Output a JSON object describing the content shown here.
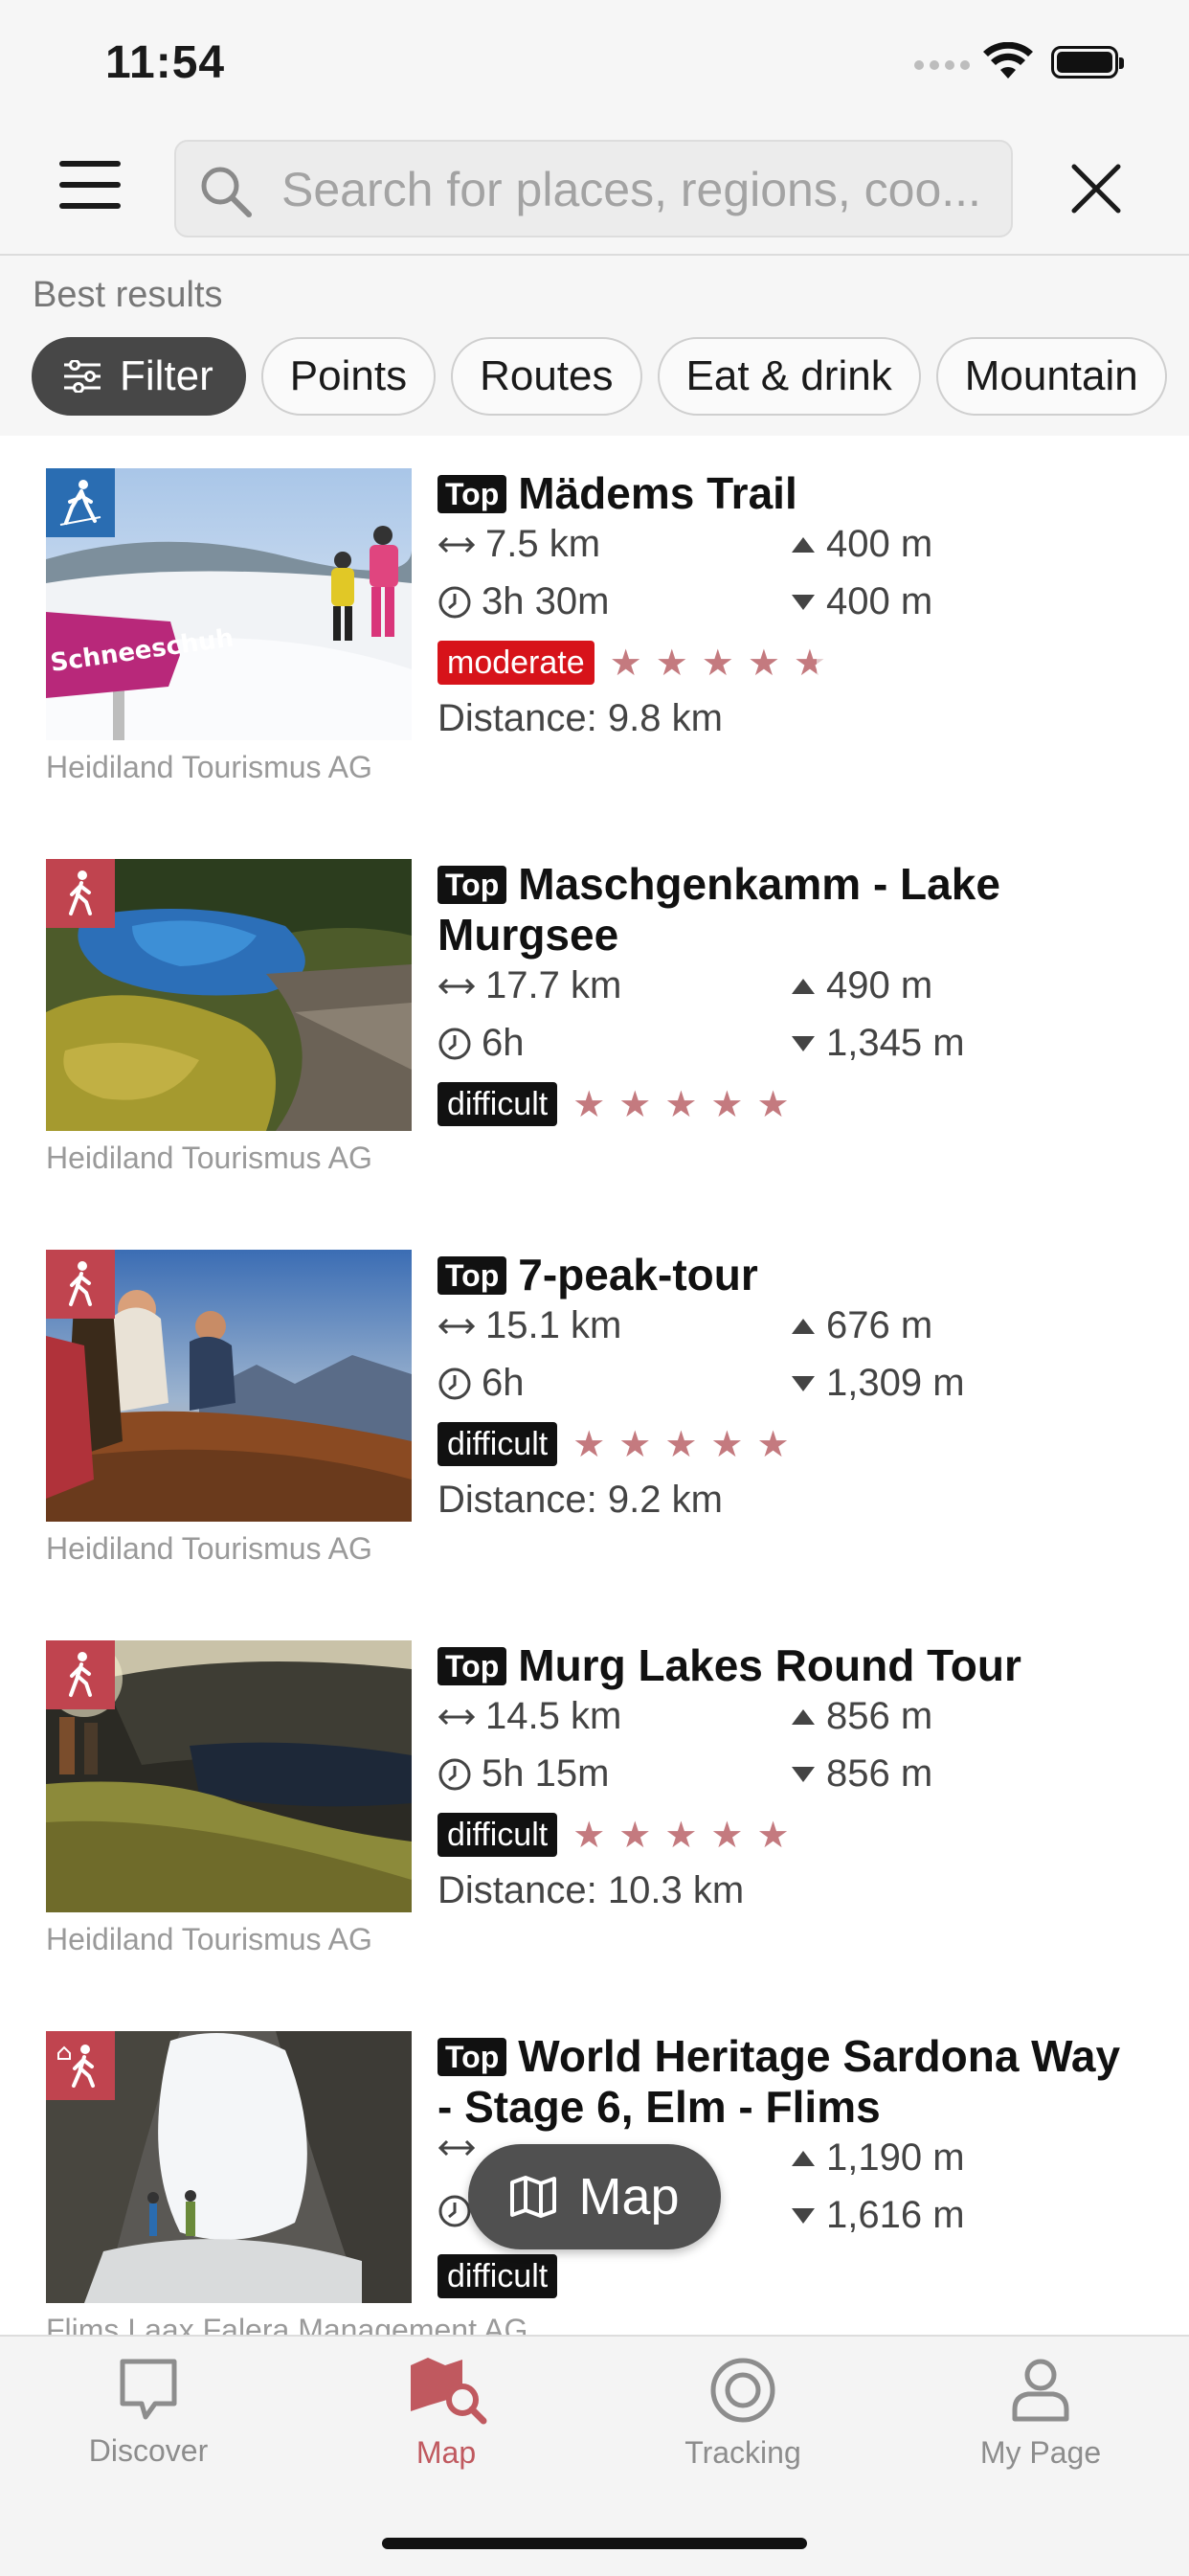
{
  "status_bar": {
    "time": "11:54"
  },
  "search": {
    "placeholder": "Search for places, regions, coo..."
  },
  "section": {
    "label": "Best results"
  },
  "chips": [
    "Filter",
    "Points",
    "Routes",
    "Eat & drink",
    "Mountain"
  ],
  "top_label": "Top",
  "results": [
    {
      "title": "Mädems Trail",
      "length": "7.5 km",
      "duration": "3h 30m",
      "ascent": "400 m",
      "descent": "400 m",
      "difficulty": "moderate",
      "rating_stars": 4.5,
      "distance": "Distance: 9.8 km",
      "credit": "Heidiland Tourismus AG",
      "activity_icon": "snowshoe-icon",
      "badge_color": "#2a6db2"
    },
    {
      "title": "Maschgenkamm - Lake Murgsee",
      "length": "17.7 km",
      "duration": "6h",
      "ascent": "490 m",
      "descent": "1,345 m",
      "difficulty": "difficult",
      "rating_stars": 5,
      "distance": "",
      "credit": "Heidiland Tourismus AG",
      "activity_icon": "hiking-icon",
      "badge_color": "#c0444f"
    },
    {
      "title": "7-peak-tour",
      "length": "15.1 km",
      "duration": "6h",
      "ascent": "676 m",
      "descent": "1,309 m",
      "difficulty": "difficult",
      "rating_stars": 5,
      "distance": "Distance: 9.2 km",
      "credit": "Heidiland Tourismus AG",
      "activity_icon": "hiking-icon",
      "badge_color": "#c0444f"
    },
    {
      "title": "Murg Lakes Round Tour",
      "length": "14.5 km",
      "duration": "5h 15m",
      "ascent": "856 m",
      "descent": "856 m",
      "difficulty": "difficult",
      "rating_stars": 5,
      "distance": "Distance: 10.3 km",
      "credit": "Heidiland Tourismus AG",
      "activity_icon": "hiking-icon",
      "badge_color": "#c0444f"
    },
    {
      "title": "World Heritage Sardona Way - Stage 6, Elm - Flims",
      "length": "",
      "duration": "",
      "ascent": "1,190 m",
      "descent": "1,616 m",
      "difficulty": "difficult",
      "rating_stars": 0,
      "distance": "",
      "credit": "Flims Laax Falera Management AG",
      "activity_icon": "hut-hiking-icon",
      "badge_color": "#c0444f"
    }
  ],
  "map_button": {
    "label": "Map"
  },
  "tabs": [
    {
      "label": "Discover",
      "icon": "discover-icon",
      "active": false
    },
    {
      "label": "Map",
      "icon": "map-search-icon",
      "active": true
    },
    {
      "label": "Tracking",
      "icon": "tracking-icon",
      "active": false
    },
    {
      "label": "My Page",
      "icon": "profile-icon",
      "active": false
    }
  ],
  "colors": {
    "accent": "#c0595f",
    "moderate": "#d7131a",
    "difficult": "#111111",
    "star": "#c47a7f"
  }
}
